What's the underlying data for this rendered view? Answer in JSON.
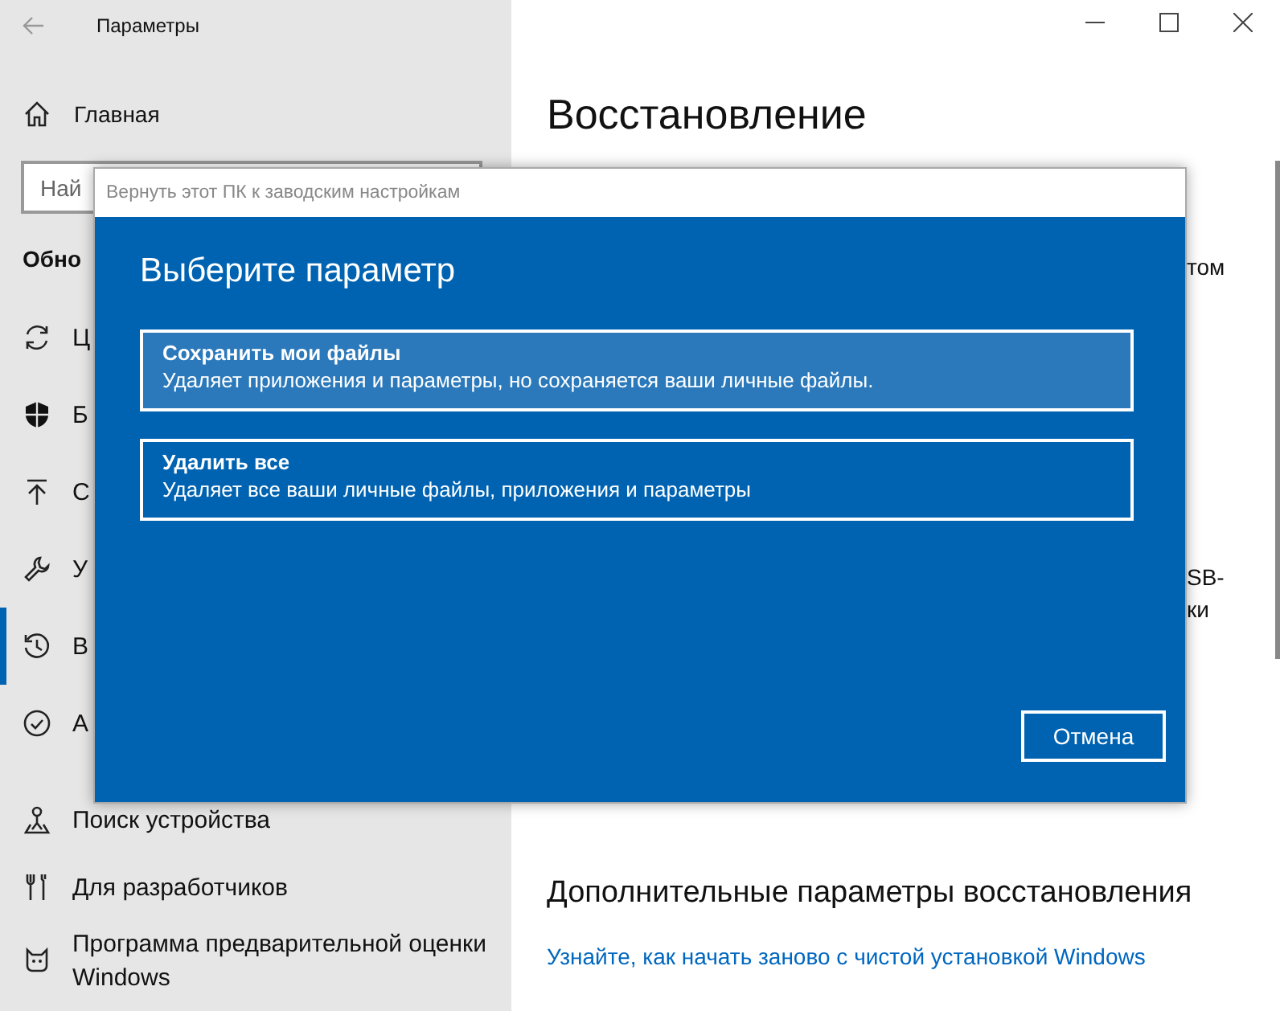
{
  "window": {
    "title": "Параметры"
  },
  "sidebar": {
    "home": "Главная",
    "search": {
      "placeholder": "Най"
    },
    "section": "Обно",
    "items": [
      {
        "label": "Ц",
        "selected": false
      },
      {
        "label": "Б",
        "selected": false
      },
      {
        "label": "С",
        "selected": false
      },
      {
        "label": "У",
        "selected": false
      },
      {
        "label": "В",
        "selected": true
      },
      {
        "label": "А",
        "selected": false
      },
      {
        "label": "Поиск устройства",
        "selected": false
      },
      {
        "label": "Для разработчиков",
        "selected": false
      },
      {
        "label": "Программа предварительной оценки Windows",
        "selected": false
      }
    ]
  },
  "main": {
    "title": "Восстановление",
    "fragments": [
      "том",
      "SB-",
      "ки"
    ],
    "section": "Дополнительные параметры восстановления",
    "link": "Узнайте, как начать заново с чистой установкой Windows"
  },
  "dialog": {
    "title": "Вернуть этот ПК к заводским настройкам",
    "heading": "Выберите параметр",
    "options": [
      {
        "title": "Сохранить мои файлы",
        "description": "Удаляет приложения и параметры, но сохраняется ваши личные файлы.",
        "selected": true
      },
      {
        "title": "Удалить все",
        "description": "Удаляет все ваши личные файлы, приложения и параметры",
        "selected": false
      }
    ],
    "cancel": "Отмена"
  }
}
